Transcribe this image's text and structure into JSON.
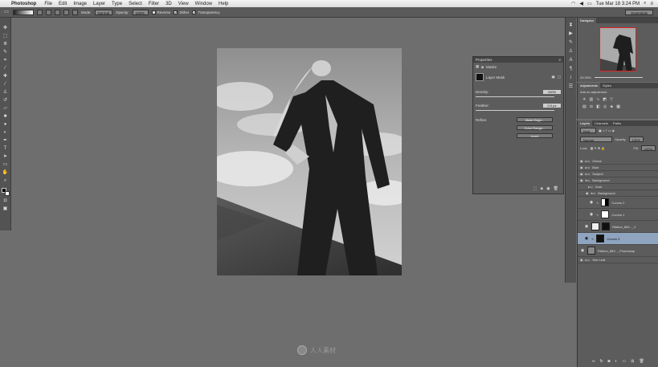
{
  "menubar": {
    "app_name": "Photoshop",
    "items": [
      "File",
      "Edit",
      "Image",
      "Layer",
      "Type",
      "Select",
      "Filter",
      "3D",
      "View",
      "Window",
      "Help"
    ],
    "clock": "Tue Mar 18  3:24 PM"
  },
  "options": {
    "mode_label": "Mode:",
    "mode_value": "Normal",
    "opacity_label": "Opacity:",
    "opacity_value": "100%",
    "reverse_label": "Reverse",
    "dither_label": "Dither",
    "transparency_label": "Transparency",
    "workspace": "Essentials"
  },
  "properties": {
    "title": "Properties",
    "subtitle": "Masks",
    "mask_type": "Layer Mask",
    "density_label": "Density:",
    "density_value": "100%",
    "feather_label": "Feather:",
    "feather_value": "0.0 px",
    "refine_label": "Refine:",
    "btn_mask_edge": "Mask Edge...",
    "btn_color_range": "Color Range...",
    "btn_invert": "Invert"
  },
  "navigator": {
    "title": "Navigator",
    "zoom": "33.33%"
  },
  "adjustments": {
    "tabs": [
      "Adjustments",
      "Styles"
    ],
    "hint": "Add an adjustment"
  },
  "layers": {
    "tabs": [
      "Layers",
      "Channels",
      "Paths"
    ],
    "kind": "Kind",
    "blend": "Normal",
    "opacity_label": "Opacity:",
    "opacity_value": "100%",
    "lock_label": "Lock:",
    "fill_label": "Fill:",
    "fill_value": "100%",
    "groups": [
      {
        "label": "Check"
      },
      {
        "label": "Blue"
      },
      {
        "label": "Subject"
      },
      {
        "label": "Background"
      },
      {
        "label": "Dust"
      },
      {
        "label": "Background"
      }
    ],
    "rows": [
      {
        "label": "Curves 2"
      },
      {
        "label": "Curves 1"
      },
      {
        "label": "Ribbon_883..._2"
      },
      {
        "label": "Curves 3"
      },
      {
        "label": "Ribbon_883..._Photoshop"
      }
    ],
    "last_group": "See Leaf"
  },
  "watermark": {
    "text": "人人素材"
  }
}
